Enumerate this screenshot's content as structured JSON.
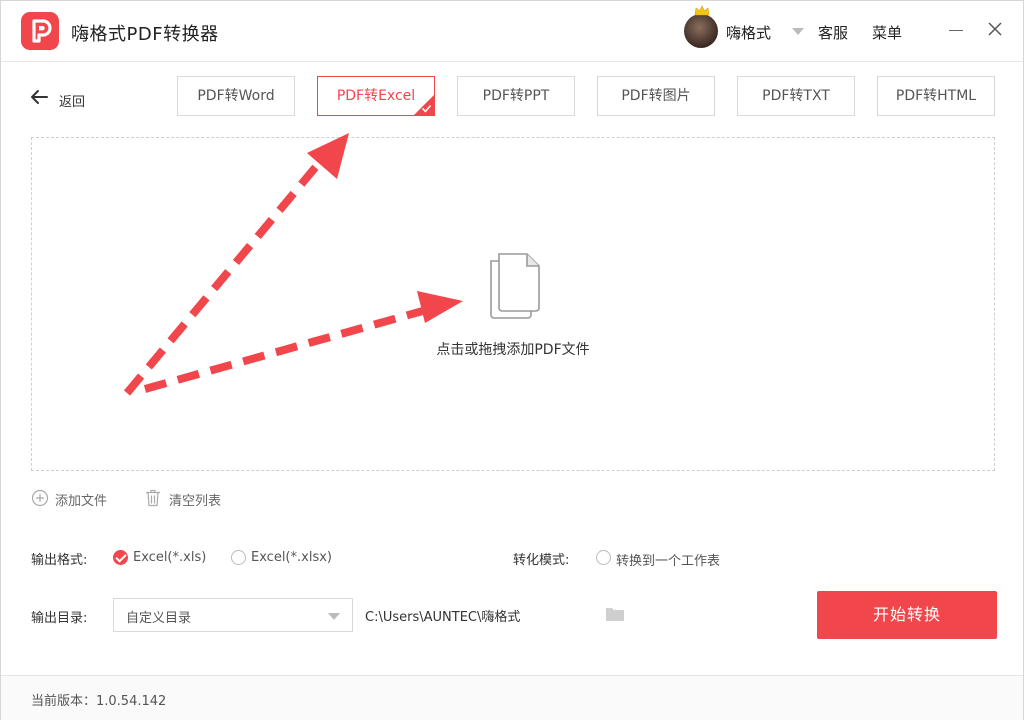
{
  "app": {
    "title": "嗨格式PDF转换器",
    "brand_color": "#f0464c",
    "logo_icon": "pdf-logo-icon"
  },
  "user": {
    "name": "嗨格式",
    "avatar_icon": "avatar-with-crown"
  },
  "header": {
    "service_label": "客服",
    "menu_label": "菜单"
  },
  "nav": {
    "back_label": "返回"
  },
  "tabs": [
    {
      "label": "PDF转Word",
      "active": false
    },
    {
      "label": "PDF转Excel",
      "active": true
    },
    {
      "label": "PDF转PPT",
      "active": false
    },
    {
      "label": "PDF转图片",
      "active": false
    },
    {
      "label": "PDF转TXT",
      "active": false
    },
    {
      "label": "PDF转HTML",
      "active": false
    }
  ],
  "dropzone": {
    "hint": "点击或拖拽添加PDF文件",
    "icon": "files-icon"
  },
  "file_actions": {
    "add_label": "添加文件",
    "clear_label": "清空列表"
  },
  "options": {
    "format_label": "输出格式:",
    "format_options": [
      {
        "label": "Excel(*.xls)",
        "checked": true
      },
      {
        "label": "Excel(*.xlsx)",
        "checked": false
      }
    ],
    "mode_label": "转化模式:",
    "mode_option": {
      "label": "转换到一个工作表",
      "checked": false
    },
    "output_dir_label": "输出目录:",
    "output_dir_select": "自定义目录",
    "output_path": "C:\\Users\\AUNTEC\\嗨格式"
  },
  "actions": {
    "start_label": "开始转换"
  },
  "footer": {
    "version": "当前版本：1.0.54.142"
  }
}
